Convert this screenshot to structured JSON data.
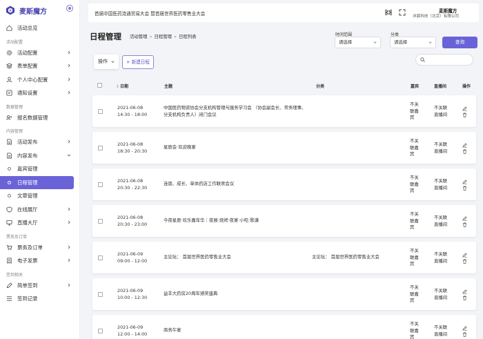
{
  "brand": {
    "name": "麦斯魔方"
  },
  "sidebar": {
    "overview": "活动总览",
    "groups": [
      {
        "title": "活动配置",
        "items": [
          {
            "label": "活动配置",
            "icon": "gear-icon"
          },
          {
            "label": "表单配置",
            "icon": "layers-icon"
          },
          {
            "label": "个人中心配置",
            "icon": "user-icon"
          },
          {
            "label": "通知设置",
            "icon": "notice-icon"
          }
        ]
      },
      {
        "title": "数据管理",
        "items": [
          {
            "label": "报名数据管理",
            "icon": "person-card-icon"
          }
        ]
      },
      {
        "title": "内容管理",
        "items": [
          {
            "label": "活动发布",
            "icon": "document-icon"
          },
          {
            "label": "内容发布",
            "icon": "document-icon"
          }
        ]
      }
    ],
    "content_sub": [
      "嘉宾管理",
      "日程管理",
      "文章管理"
    ],
    "more_items": [
      {
        "label": "在线展厅",
        "icon": "shield-icon"
      },
      {
        "label": "直播大厅",
        "icon": "monitor-icon"
      }
    ],
    "ticket_title": "票务及订单",
    "ticket_items": [
      {
        "label": "票务及订单",
        "icon": "cart-icon"
      },
      {
        "label": "电子发票",
        "icon": "invoice-icon"
      }
    ],
    "sign_title": "签到相关",
    "sign_items": [
      {
        "label": "简单签到",
        "icon": "pen-icon"
      },
      {
        "label": "签到记录",
        "icon": "list-icon"
      }
    ]
  },
  "header": {
    "title": "首届中国医药流通贸易大会 暨首届世界医药零售业大会",
    "user_name": "麦斯魔方",
    "user_org": "沐宸科技（北京）有限公司"
  },
  "page": {
    "title": "日程管理",
    "breadcrumb": [
      "活动管理",
      "日程管理",
      "日程列表"
    ]
  },
  "filters": {
    "time_label": "时间范围",
    "time_value": "请选择",
    "category_label": "分类",
    "category_value": "请选择",
    "query_label": "查询"
  },
  "toolbar": {
    "ops_label": "操作",
    "new_label": "+ 新建日程"
  },
  "table": {
    "headers": {
      "date": "日期",
      "topic": "主题",
      "category": "分类",
      "guest": "嘉宾",
      "live": "直播间",
      "ops": "操作"
    },
    "rows": [
      {
        "date": "2021-06-08",
        "time": "14:30 - 18:00",
        "topic": "中国医药物资协会分支机构管理与服务学习会 （协会副会长、常务理事、分支机构负责人）闭门会议",
        "category": "",
        "guest": "不关联嘉宾",
        "live": "不关联直播间"
      },
      {
        "date": "2021-06-08",
        "time": "18:30 - 20:30",
        "topic": "星辰会·欢迎晚宴",
        "category": "",
        "guest": "不关联嘉宾",
        "live": "不关联直播间"
      },
      {
        "date": "2021-06-08",
        "time": "20:30 - 22:30",
        "topic": "连锁、成长、单体药店工作联席会议",
        "category": "",
        "guest": "不关联嘉宾",
        "live": "不关联直播间"
      },
      {
        "date": "2021-06-08",
        "time": "20:30 - 23:00",
        "topic": "今夜星辰·欢乐嘉年华｜夜展·烧烤·夜宴·小吃·歌谦",
        "category": "",
        "guest": "不关联嘉宾",
        "live": "不关联直播间"
      },
      {
        "date": "2021-06-09",
        "time": "09:00 - 12:00",
        "topic": "主论坛： 首届世界医药零售业大会",
        "category": "主论坛： 首届世界医药零售业大会",
        "guest": "不关联嘉宾",
        "live": "不关联直播间"
      },
      {
        "date": "2021-06-09",
        "time": "10:00 - 12:30",
        "topic": "益丰大药房20周年颁奖盛典",
        "category": "",
        "guest": "不关联嘉宾",
        "live": "不关联直播间"
      },
      {
        "date": "2021-06-09",
        "time": "12:00 - 14:00",
        "topic": "商务午宴",
        "category": "",
        "guest": "不关联嘉宾",
        "live": "不关联直播间"
      }
    ]
  }
}
